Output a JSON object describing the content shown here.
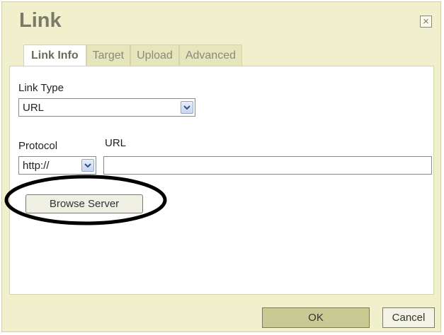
{
  "dialog": {
    "title": "Link",
    "close_symbol": "×"
  },
  "tabs": [
    {
      "label": "Link Info",
      "active": true
    },
    {
      "label": "Target",
      "active": false
    },
    {
      "label": "Upload",
      "active": false
    },
    {
      "label": "Advanced",
      "active": false
    }
  ],
  "link_info": {
    "link_type_label": "Link Type",
    "link_type_value": "URL",
    "protocol_label": "Protocol",
    "protocol_value": "http://",
    "url_label": "URL",
    "url_value": "",
    "browse_button": "Browse Server"
  },
  "footer": {
    "ok_label": "OK",
    "cancel_label": "Cancel"
  },
  "icons": {
    "dropdown": "chevron-down-icon",
    "close": "close-icon"
  },
  "colors": {
    "dialog_bg": "#f0f0cc",
    "highlight_ring": "#000000",
    "ok_button": "#c9c994"
  }
}
